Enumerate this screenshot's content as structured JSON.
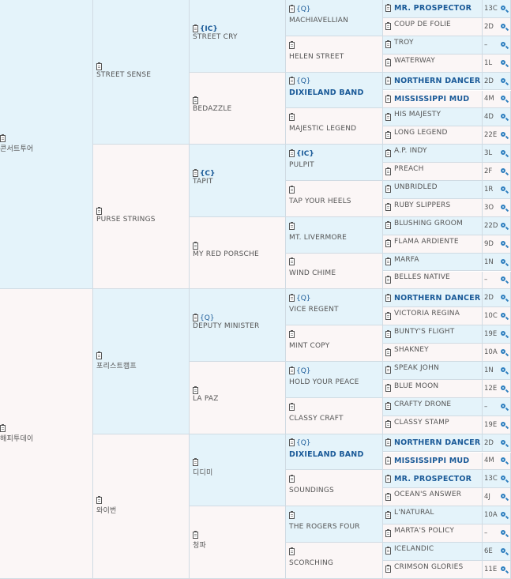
{
  "gen1": [
    {
      "name": "콘서트투어"
    },
    {
      "name": "해피투데이"
    }
  ],
  "gen2": [
    {
      "name": "STREET SENSE"
    },
    {
      "name": "PURSE STRINGS"
    },
    {
      "name": "포리스트캠프"
    },
    {
      "name": "와이번"
    }
  ],
  "gen3": [
    {
      "tag": "{IC}",
      "tag_bold": true,
      "name": "STREET CRY"
    },
    {
      "tag": "",
      "tag_bold": false,
      "name": "BEDAZZLE"
    },
    {
      "tag": "{C}",
      "tag_bold": true,
      "name": "TAPIT"
    },
    {
      "tag": "",
      "tag_bold": false,
      "name": "MY RED PORSCHE"
    },
    {
      "tag": "{Q}",
      "tag_bold": false,
      "name": "DEPUTY MINISTER"
    },
    {
      "tag": "",
      "tag_bold": false,
      "name": "LA PAZ"
    },
    {
      "tag": "",
      "tag_bold": false,
      "name": "디디미"
    },
    {
      "tag": "",
      "tag_bold": false,
      "name": "청파"
    }
  ],
  "gen4": [
    {
      "tag": "{Q}",
      "tag_bold": false,
      "name": "MACHIAVELLIAN",
      "strong": false
    },
    {
      "tag": "",
      "tag_bold": false,
      "name": "HELEN STREET",
      "strong": false
    },
    {
      "tag": "{Q}",
      "tag_bold": false,
      "name": "DIXIELAND BAND",
      "strong": true
    },
    {
      "tag": "",
      "tag_bold": false,
      "name": "MAJESTIC LEGEND",
      "strong": false
    },
    {
      "tag": "{IC}",
      "tag_bold": true,
      "name": "PULPIT",
      "strong": false
    },
    {
      "tag": "",
      "tag_bold": false,
      "name": "TAP YOUR HEELS",
      "strong": false
    },
    {
      "tag": "",
      "tag_bold": false,
      "name": "MT. LIVERMORE",
      "strong": false
    },
    {
      "tag": "",
      "tag_bold": false,
      "name": "WIND CHIME",
      "strong": false
    },
    {
      "tag": "{Q}",
      "tag_bold": false,
      "name": "VICE REGENT",
      "strong": false
    },
    {
      "tag": "",
      "tag_bold": false,
      "name": "MINT COPY",
      "strong": false
    },
    {
      "tag": "{Q}",
      "tag_bold": false,
      "name": "HOLD YOUR PEACE",
      "strong": false
    },
    {
      "tag": "",
      "tag_bold": false,
      "name": "CLASSY CRAFT",
      "strong": false
    },
    {
      "tag": "{Q}",
      "tag_bold": false,
      "name": "DIXIELAND BAND",
      "strong": true
    },
    {
      "tag": "",
      "tag_bold": false,
      "name": "SOUNDINGS",
      "strong": false
    },
    {
      "tag": "",
      "tag_bold": false,
      "name": "THE ROGERS FOUR",
      "strong": false
    },
    {
      "tag": "",
      "tag_bold": false,
      "name": "SCORCHING",
      "strong": false
    }
  ],
  "gen5": [
    {
      "name": "MR. PROSPECTOR",
      "code": "13C",
      "strong": true
    },
    {
      "name": "COUP DE FOLIE",
      "code": "2D",
      "strong": false
    },
    {
      "name": "TROY",
      "code": "–",
      "strong": false
    },
    {
      "name": "WATERWAY",
      "code": "1L",
      "strong": false
    },
    {
      "name": "NORTHERN DANCER",
      "code": "2D",
      "strong": true
    },
    {
      "name": "MISSISSIPPI MUD",
      "code": "4M",
      "strong": true
    },
    {
      "name": "HIS MAJESTY",
      "code": "4D",
      "strong": false
    },
    {
      "name": "LONG LEGEND",
      "code": "22E",
      "strong": false
    },
    {
      "name": "A.P. INDY",
      "code": "3L",
      "strong": false
    },
    {
      "name": "PREACH",
      "code": "2F",
      "strong": false
    },
    {
      "name": "UNBRIDLED",
      "code": "1R",
      "strong": false
    },
    {
      "name": "RUBY SLIPPERS",
      "code": "3O",
      "strong": false
    },
    {
      "name": "BLUSHING GROOM",
      "code": "22D",
      "strong": false
    },
    {
      "name": "FLAMA ARDIENTE",
      "code": "9D",
      "strong": false
    },
    {
      "name": "MARFA",
      "code": "1N",
      "strong": false
    },
    {
      "name": "BELLES NATIVE",
      "code": "–",
      "strong": false
    },
    {
      "name": "NORTHERN DANCER",
      "code": "2D",
      "strong": true
    },
    {
      "name": "VICTORIA REGINA",
      "code": "10C",
      "strong": false
    },
    {
      "name": "BUNTY'S FLIGHT",
      "code": "19E",
      "strong": false
    },
    {
      "name": "SHAKNEY",
      "code": "10A",
      "strong": false
    },
    {
      "name": "SPEAK JOHN",
      "code": "1N",
      "strong": false
    },
    {
      "name": "BLUE MOON",
      "code": "12E",
      "strong": false
    },
    {
      "name": "CRAFTY DRONE",
      "code": "–",
      "strong": false
    },
    {
      "name": "CLASSY STAMP",
      "code": "19E",
      "strong": false
    },
    {
      "name": "NORTHERN DANCER",
      "code": "2D",
      "strong": true
    },
    {
      "name": "MISSISSIPPI MUD",
      "code": "4M",
      "strong": true
    },
    {
      "name": "MR. PROSPECTOR",
      "code": "13C",
      "strong": true
    },
    {
      "name": "OCEAN'S ANSWER",
      "code": "4J",
      "strong": false
    },
    {
      "name": "L'NATURAL",
      "code": "10A",
      "strong": false
    },
    {
      "name": "MARTA'S POLICY",
      "code": "–",
      "strong": false
    },
    {
      "name": "ICELANDIC",
      "code": "6E",
      "strong": false
    },
    {
      "name": "CRIMSON GLORIES",
      "code": "11E",
      "strong": false
    }
  ],
  "colors": {
    "highlight": "#1a5a98",
    "blue_cell": "#e4f3fa",
    "pink_cell": "#fbf6f6",
    "border": "#d0dbe3"
  },
  "icons": {
    "record": "clipboard-icon",
    "search": "magnifier-icon"
  }
}
